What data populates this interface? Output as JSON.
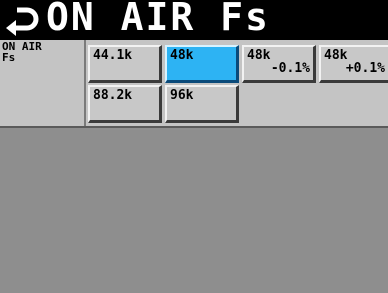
{
  "header": {
    "title": "ON AIR Fs",
    "back_icon": "return-arrow-icon"
  },
  "row_label": "ON AIR\nFs",
  "options": [
    {
      "line1": "44.1k",
      "line2": "",
      "selected": false
    },
    {
      "line1": "48k",
      "line2": "",
      "selected": true
    },
    {
      "line1": "48k",
      "line2": "-0.1%",
      "selected": false
    },
    {
      "line1": "48k",
      "line2": "+0.1%",
      "selected": false
    },
    {
      "line1": "88.2k",
      "line2": "",
      "selected": false
    },
    {
      "line1": "96k",
      "line2": "",
      "selected": false
    }
  ],
  "colors": {
    "selected": "#2db3f3",
    "button": "#c8c8c8",
    "panel": "#8e8e8e"
  }
}
